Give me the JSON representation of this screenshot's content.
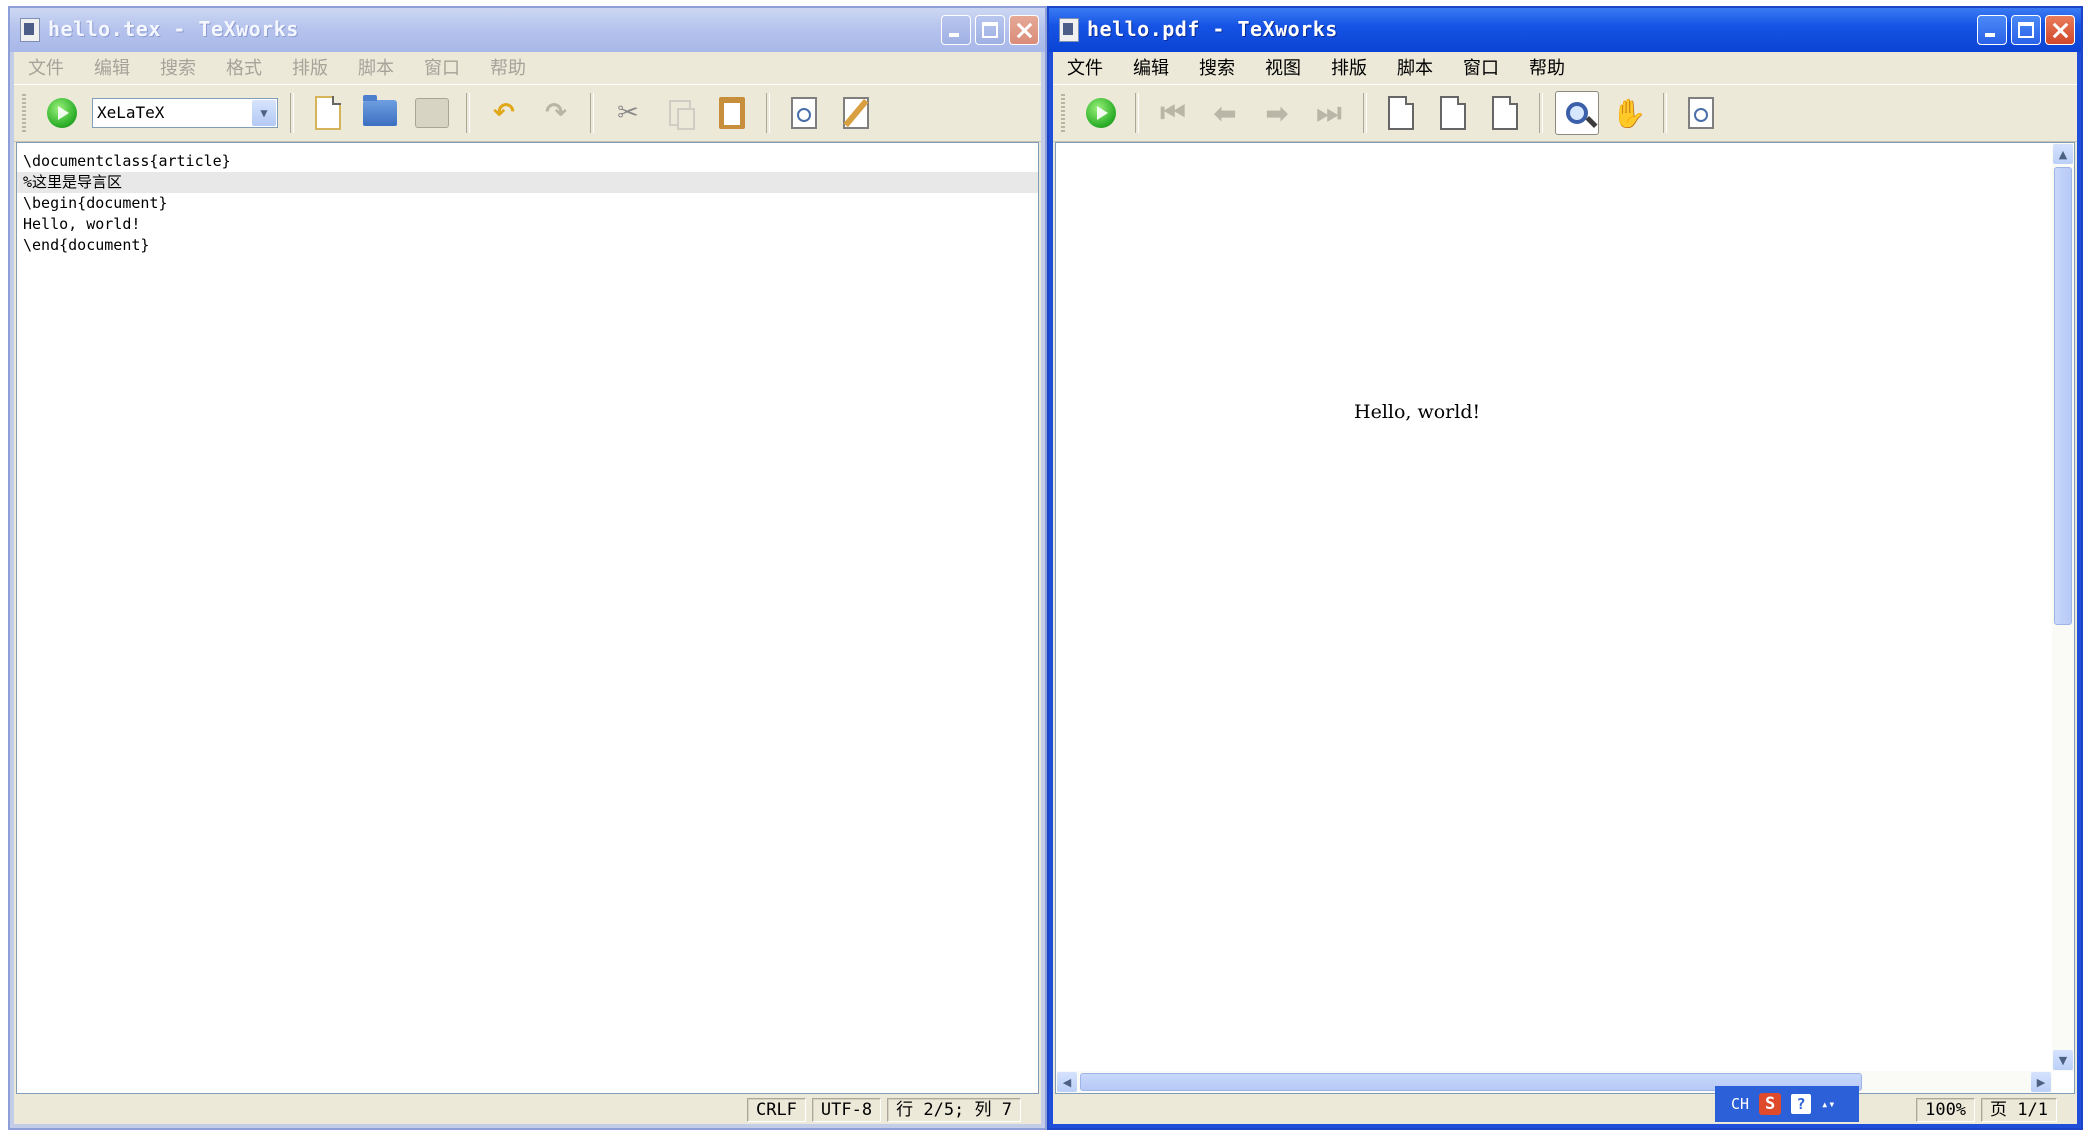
{
  "editor_window": {
    "title": "hello.tex - TeXworks",
    "menus": [
      "文件",
      "编辑",
      "搜索",
      "格式",
      "排版",
      "脚本",
      "窗口",
      "帮助"
    ],
    "engine": "XeLaTeX",
    "lines": [
      "\\documentclass{article}",
      "%这里是导言区",
      "\\begin{document}",
      "Hello, world!",
      "\\end{document}"
    ],
    "status": {
      "line_ending": "CRLF",
      "encoding": "UTF-8",
      "position": "行 2/5; 列 7"
    }
  },
  "pdf_window": {
    "title": "hello.pdf - TeXworks",
    "menus": [
      "文件",
      "编辑",
      "搜索",
      "视图",
      "排版",
      "脚本",
      "窗口",
      "帮助"
    ],
    "page_text": "Hello, world!",
    "status": {
      "zoom": "100%",
      "page": "页 1/1"
    },
    "ime": {
      "mode": "CH",
      "s_label": "S",
      "help": "?"
    }
  },
  "colors": {
    "active_title": "#1654e5",
    "inactive_title": "#b4c2ec",
    "face": "#ece9d8"
  }
}
